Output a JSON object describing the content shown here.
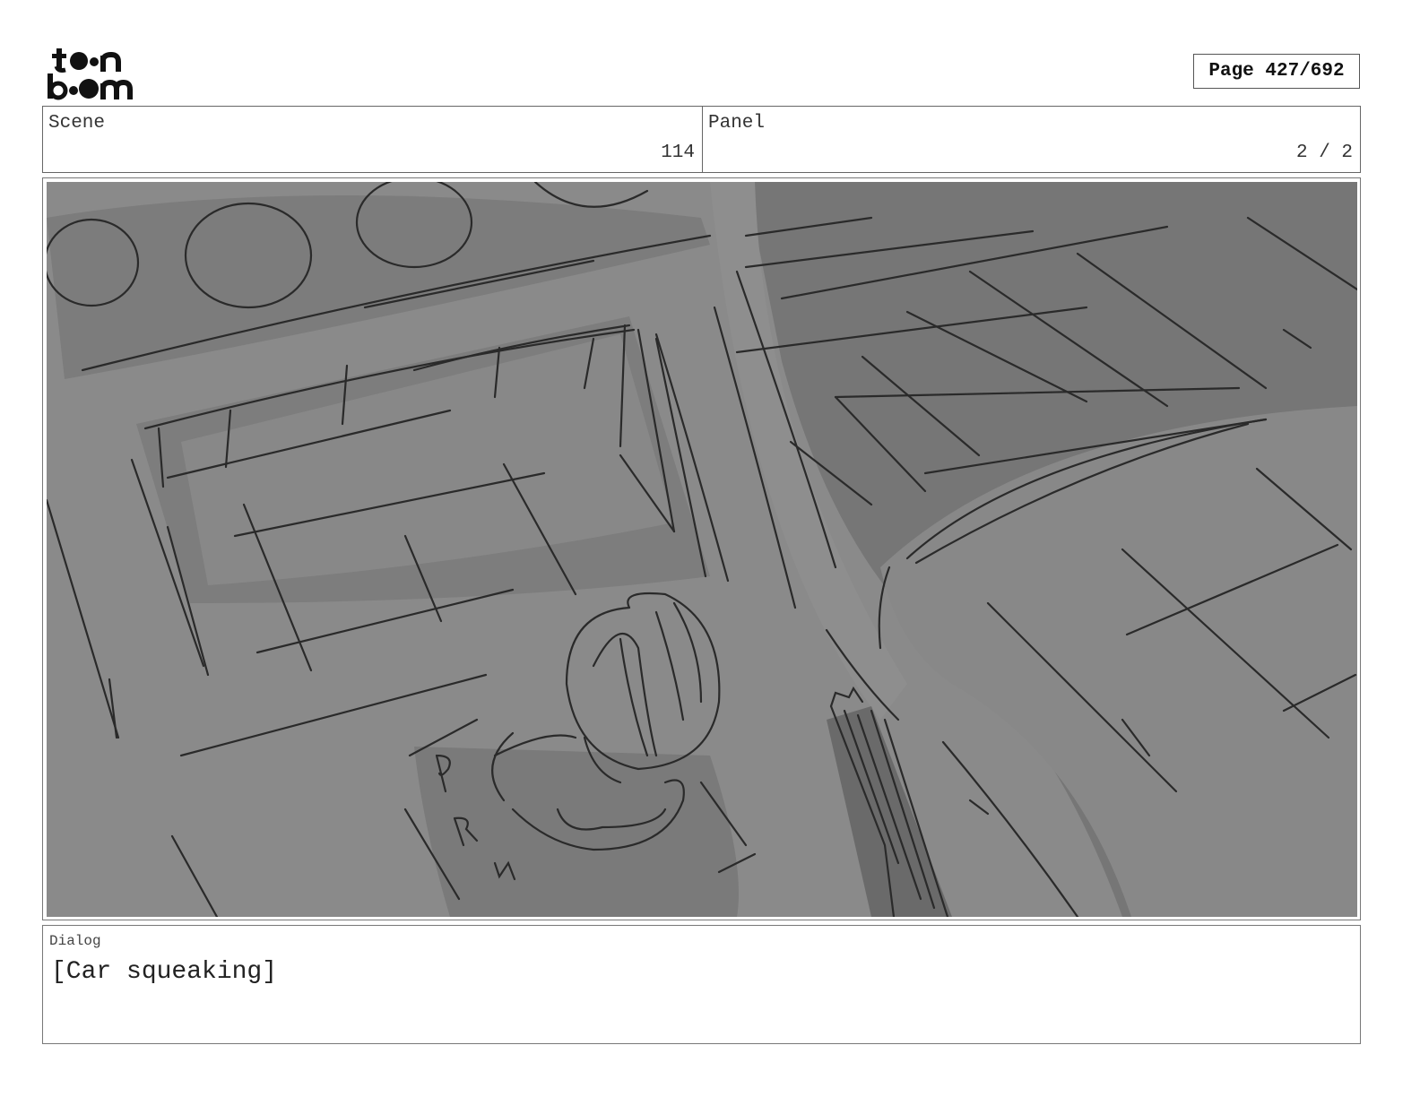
{
  "logo": {
    "line1": "to•n",
    "line2": "b•om",
    "name": "toon boom"
  },
  "page": {
    "label": "Page 427/692"
  },
  "scene": {
    "label": "Scene",
    "value": "114"
  },
  "panel": {
    "label": "Panel",
    "value": "2 / 2"
  },
  "dialog": {
    "label": "Dialog",
    "text": "[Car squeaking]"
  },
  "artwork": {
    "description_icon": "storyboard-sketch-car-interior"
  }
}
